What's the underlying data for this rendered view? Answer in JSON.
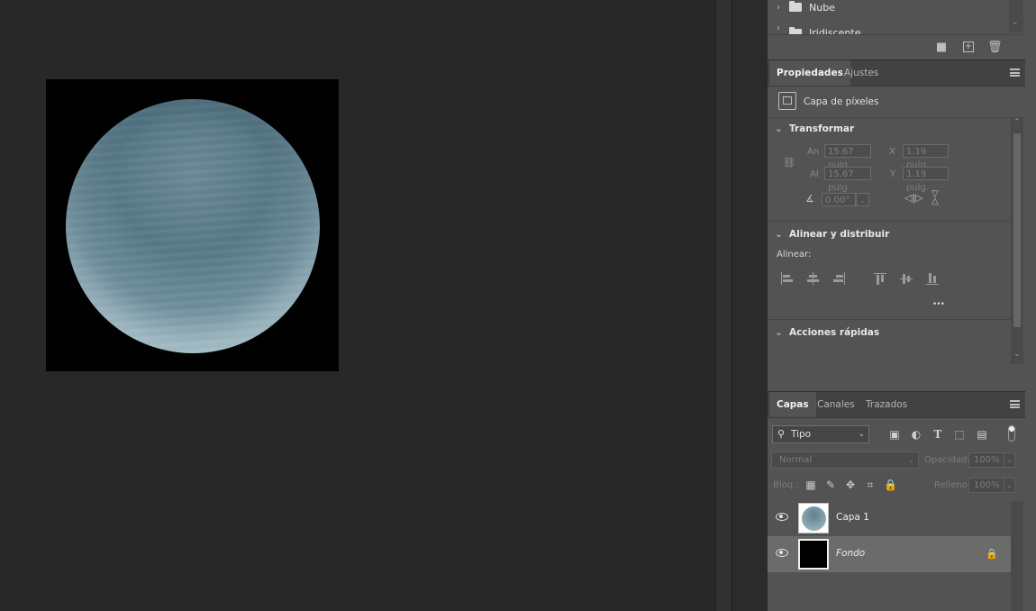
{
  "top_layers": {
    "folders": [
      {
        "name": "Nube"
      },
      {
        "name": "Iridiscente"
      }
    ]
  },
  "properties": {
    "tabs": [
      {
        "label": "Propiedades",
        "active": true
      },
      {
        "label": "Ajustes",
        "active": false
      }
    ],
    "layer_type": "Capa de píxeles",
    "transform": {
      "title": "Transformar",
      "an_label": "An",
      "an_value": "15.67 pulg",
      "al_label": "Al",
      "al_value": "15.67 pulg",
      "x_label": "X",
      "x_value": "1.19 pulg.",
      "y_label": "Y",
      "y_value": "1.19 pulg.",
      "angle_value": "0.00°"
    },
    "align": {
      "title": "Alinear y distribuir",
      "label": "Alinear:",
      "more": "•••"
    },
    "quick_actions": {
      "title": "Acciones rápidas"
    }
  },
  "layers": {
    "tabs": [
      {
        "label": "Capas",
        "active": true
      },
      {
        "label": "Canales",
        "active": false
      },
      {
        "label": "Trazados",
        "active": false
      }
    ],
    "filter_value": "Tipo",
    "blend_mode": "Normal",
    "opacity_label": "Opacidad:",
    "opacity_value": "100%",
    "lock_label": "Bloq.:",
    "fill_label": "Relleno:",
    "fill_value": "100%",
    "items": [
      {
        "name": "Capa 1",
        "selected": false,
        "locked": false
      },
      {
        "name": "Fondo",
        "selected": true,
        "locked": true
      }
    ]
  },
  "colors": {
    "panel_bg": "#535353",
    "canvas_bg": "#282828",
    "selected_row": "#6b6b6b"
  }
}
